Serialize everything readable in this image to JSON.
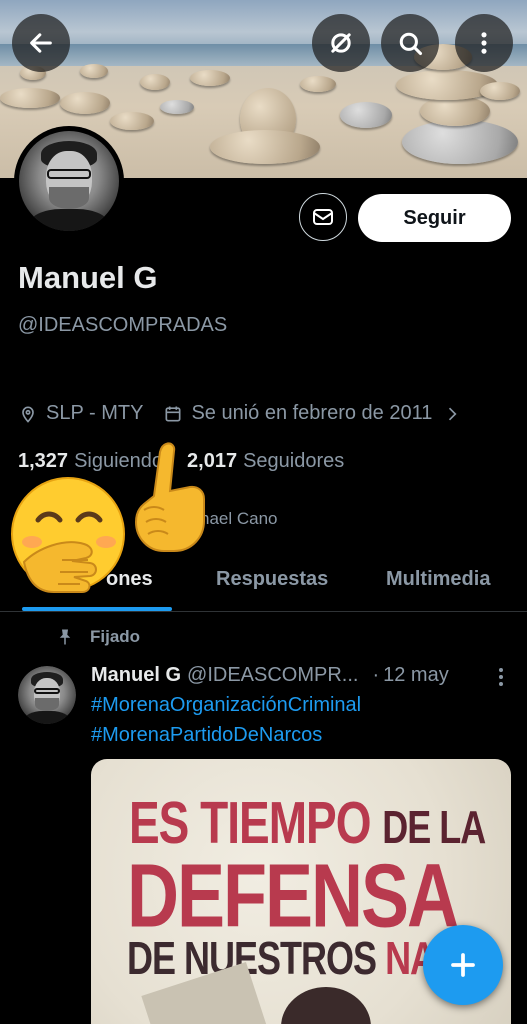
{
  "profile": {
    "name": "Manuel G",
    "handle": "@IDEASCOMPRADAS",
    "location": "SLP - MTY",
    "joined": "Se unió en febrero de 2011",
    "following_count": "1,327",
    "following_label": "Siguiendo",
    "followers_count": "2,017",
    "followers_label": "Seguidores",
    "followed_by": "nael Cano"
  },
  "actions": {
    "follow_label": "Seguir",
    "message_icon": "envelope-icon"
  },
  "top_bar": {
    "back_icon": "arrow-left-icon",
    "grok_icon": "slash-circle-icon",
    "search_icon": "search-icon",
    "more_icon": "more-vertical-icon"
  },
  "tabs": [
    {
      "label": "ones",
      "active": true
    },
    {
      "label": "Respuestas",
      "active": false
    },
    {
      "label": "Multimedia",
      "active": false
    }
  ],
  "pinned_tweet": {
    "pinned_label": "Fijado",
    "author_name": "Manuel G",
    "author_handle": "@IDEASCOMPR...",
    "date": "12 may",
    "hashtags": [
      "#MorenaOrganizaciónCriminal",
      "#MorenaPartidoDeNarcos"
    ],
    "media_text": {
      "line1_a": "ES TIEMPO",
      "line1_b": "DE LA",
      "line2": "DEFENSA",
      "line3_a": "DE NUESTROS",
      "line3_b": "NAR"
    }
  },
  "colors": {
    "accent": "#1d9bf0",
    "background": "#000000",
    "secondary_text": "#8b98a5",
    "poster_red": "#b83a4e"
  }
}
